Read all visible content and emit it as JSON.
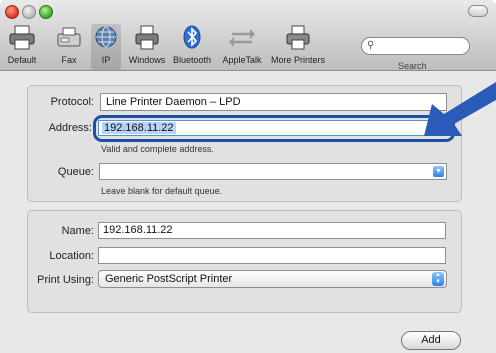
{
  "toolbar": {
    "items": [
      {
        "label": "Default",
        "icon": "printer-default-icon"
      },
      {
        "label": "Fax",
        "icon": "fax-icon"
      },
      {
        "label": "IP",
        "icon": "ip-globe-icon",
        "selected": true
      },
      {
        "label": "Windows",
        "icon": "windows-printer-icon"
      },
      {
        "label": "Bluetooth",
        "icon": "bluetooth-icon"
      },
      {
        "label": "AppleTalk",
        "icon": "appletalk-icon"
      },
      {
        "label": "More Printers",
        "icon": "more-printers-icon"
      }
    ],
    "search_label": "Search",
    "search_value": ""
  },
  "form": {
    "protocol_label": "Protocol:",
    "protocol_value": "Line Printer Daemon – LPD",
    "address_label": "Address:",
    "address_value": "192.168.11.22",
    "address_hint": "Valid and complete address.",
    "queue_label": "Queue:",
    "queue_value": "",
    "queue_hint": "Leave blank for default queue.",
    "name_label": "Name:",
    "name_value": "192.168.11.22",
    "location_label": "Location:",
    "location_value": "",
    "print_using_label": "Print Using:",
    "print_using_value": "Generic PostScript Printer"
  },
  "add_button_label": "Add",
  "colors": {
    "callout_arrow": "#2b5bb8",
    "highlight_ring": "#1d4fa8",
    "accent_blue": "#2f7ee8"
  }
}
